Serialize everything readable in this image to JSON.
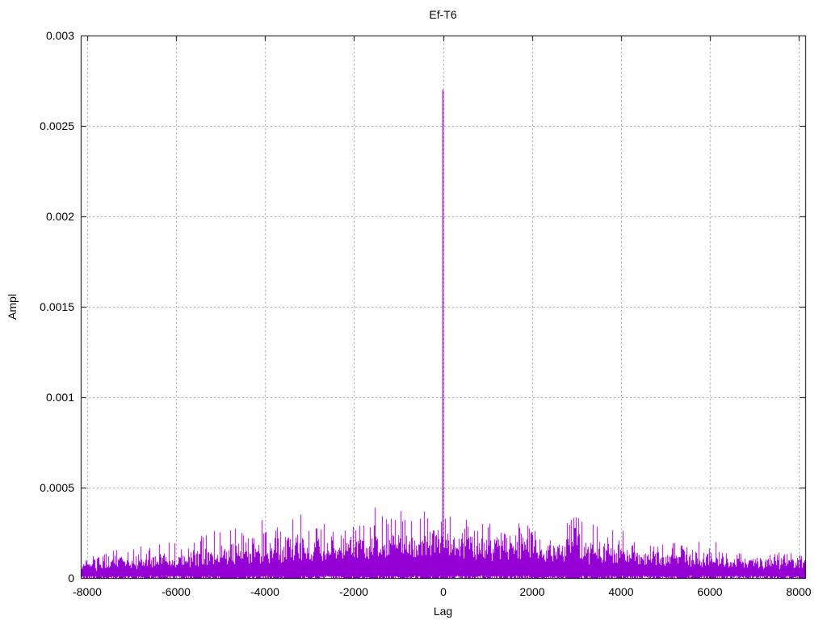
{
  "chart_data": {
    "type": "line",
    "style": "dense-impulse-noise",
    "title": "Ef-T6",
    "xlabel": "Lag",
    "ylabel": "Ampl",
    "series_color": "#9400d3",
    "border_color": "#000000",
    "grid": {
      "visible": true,
      "style": "dotted",
      "color": "#9c9c9c"
    },
    "legend": "none",
    "xlim": [
      -8150,
      8150
    ],
    "ylim": [
      0,
      0.003
    ],
    "x_ticks": {
      "values": [
        -8000,
        -6000,
        -4000,
        -2000,
        0,
        2000,
        4000,
        6000,
        8000
      ],
      "labels": [
        "-8000",
        "-6000",
        "-4000",
        "-2000",
        "0",
        "2000",
        "4000",
        "6000",
        "8000"
      ]
    },
    "y_ticks": {
      "values": [
        0,
        0.0005,
        0.001,
        0.0015,
        0.002,
        0.0025,
        0.003
      ],
      "labels": [
        "0",
        "0.0005",
        "0.001",
        "0.0015",
        "0.002",
        "0.0025",
        "0.003"
      ]
    },
    "center_spike": {
      "x": 0,
      "y": 0.0027
    },
    "noise_envelope": {
      "lags": [
        -8150,
        -7000,
        -6000,
        -5000,
        -4000,
        -3000,
        -2000,
        -1000,
        0,
        1000,
        2000,
        3000,
        4000,
        5000,
        6000,
        7000,
        8150
      ],
      "mass": [
        6e-05,
        7e-05,
        8e-05,
        0.0001,
        0.00012,
        0.00014,
        0.00015,
        0.00016,
        0.00017,
        0.00015,
        0.00014,
        0.00013,
        0.00011,
        9e-05,
        8e-05,
        7e-05,
        7e-05
      ],
      "peak": [
        0.00012,
        0.00016,
        0.0002,
        0.00026,
        0.00026,
        0.0003,
        0.0003,
        0.00038,
        0.00035,
        0.0003,
        0.0003,
        0.00033,
        0.00024,
        0.0002,
        0.00016,
        0.00014,
        0.00014
      ]
    },
    "notable_spikes": [
      {
        "x": -5150,
        "y": 0.00026
      },
      {
        "x": -4300,
        "y": 0.00022
      },
      {
        "x": -1530,
        "y": 0.00039
      },
      {
        "x": -950,
        "y": 0.00037
      },
      {
        "x": -350,
        "y": 0.00033
      },
      {
        "x": 150,
        "y": 0.00034
      },
      {
        "x": 1050,
        "y": 0.0003
      },
      {
        "x": 1900,
        "y": 0.00029
      },
      {
        "x": 3050,
        "y": 0.00033
      },
      {
        "x": 4050,
        "y": 0.00026
      },
      {
        "x": 5760,
        "y": 0.0002
      }
    ],
    "noise_seed": 1337
  }
}
